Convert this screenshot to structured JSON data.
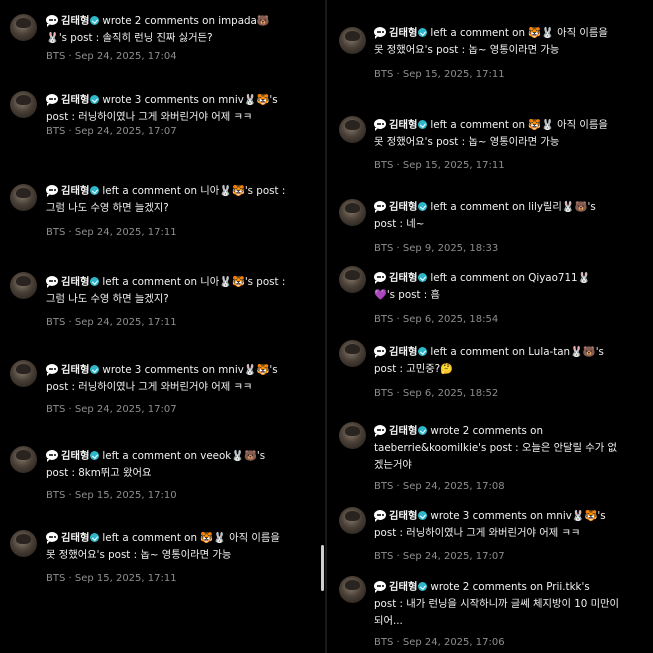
{
  "left_items": [
    {
      "name": "김태형",
      "text": "wrote 2 comments on impada🐻",
      "line2": "🐰's post : 솔직히 런닝 진짜 싫거든?",
      "meta": "BTS · Sep 24, 2025, 17:04"
    },
    {
      "name": "김태형",
      "text": "wrote 3 comments on mniv🐰🐯's",
      "line2": "post : 러닝하이였나 그게 와버린거야 어제 ㅋㅋ",
      "meta": "BTS · Sep 24, 2025, 17:07"
    },
    {
      "name": "김태형",
      "text": "left a comment on 니아🐰🐯's post :",
      "line2": "그럼 나도 수영 하면 늘겠지?",
      "meta": "BTS · Sep 24, 2025, 17:11"
    },
    {
      "name": "김태형",
      "text": "left a comment on 니아🐰🐯's post :",
      "line2": "그럼 나도 수영 하면 늘겠지?",
      "meta": "BTS · Sep 24, 2025, 17:11"
    },
    {
      "name": "김태형",
      "text": "wrote 3 comments on mniv🐰🐯's",
      "line2": "post : 러닝하이였나 그게 와버린거야 어제 ㅋㅋ",
      "meta": "BTS · Sep 24, 2025, 17:07"
    },
    {
      "name": "김태형",
      "text": "left a comment on veeok🐰🐻's",
      "line2": "post : 8km뛰고 왔어요",
      "meta": "BTS · Sep 15, 2025, 17:10"
    },
    {
      "name": "김태형",
      "text": "left a comment on 🐯🐰 아직 이름을",
      "line2": "못 정했어요's post : 놉~ 영통이라면 가능",
      "meta": "BTS · Sep 15, 2025, 17:11"
    }
  ],
  "right_items": [
    {
      "name": "김태형",
      "text": "left a comment on 🐯🐰 아직 이름을",
      "line2": "못 정했어요's post : 놉~ 영통이라면 가능",
      "meta": "BTS · Sep 15, 2025, 17:11"
    },
    {
      "name": "김태형",
      "text": "left a comment on 🐯🐰 아직 이름을",
      "line2": "못 정했어요's post : 놉~ 영통이라면 가능",
      "meta": "BTS · Sep 15, 2025, 17:11"
    },
    {
      "name": "김태형",
      "text": "left a comment on lily릴리🐰🐻's",
      "line2": "post : 네~",
      "meta": "BTS · Sep 9, 2025, 18:33"
    },
    {
      "name": "김태형",
      "text": "left a comment on Qiyao711🐰",
      "line2": "💜's post : 흠",
      "meta": "BTS · Sep 6, 2025, 18:54"
    },
    {
      "name": "김태형",
      "text": "left a comment on Lula-tan🐰🐻's",
      "line2": "post : 고민중?🤔",
      "meta": "BTS · Sep 6, 2025, 18:52"
    },
    {
      "name": "김태형",
      "text": "wrote 2 comments on",
      "line2": "taeberrie&koomilkie's post : 오늘은 안달릴 수가 없",
      "line3": "겠는거야",
      "meta": "BTS · Sep 24, 2025, 17:08"
    },
    {
      "name": "김태형",
      "text": "wrote 3 comments on mniv🐰🐯's",
      "line2": "post : 러닝하이였나 그게 와버린거야 어제 ㅋㅋ",
      "meta": "BTS · Sep 24, 2025, 17:07"
    },
    {
      "name": "김태형",
      "text": "wrote 2 comments on Prii.tkk's",
      "line2": "post : 내가 런닝을 시작하니까 글쎄 체지방이 10 미만이",
      "line3": "되어...",
      "meta": "BTS · Sep 24, 2025, 17:06"
    }
  ]
}
